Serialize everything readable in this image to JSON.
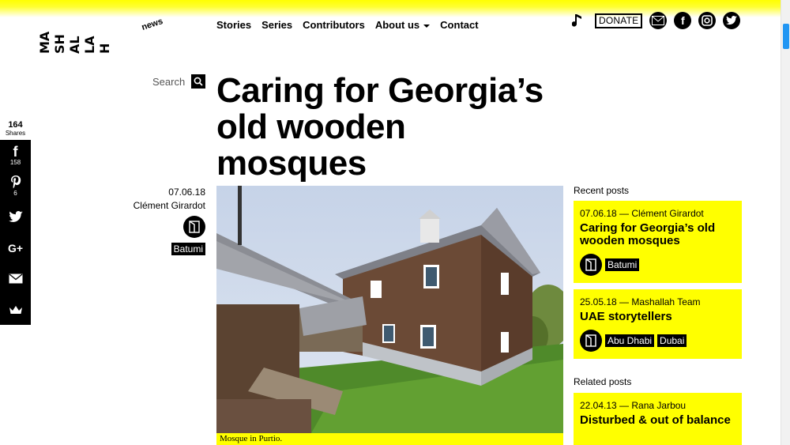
{
  "logo": {
    "text": "MA SH AL LA H",
    "lines": [
      "MA",
      "SH",
      "AL",
      "LA",
      "H"
    ],
    "tagline": "news"
  },
  "nav": {
    "items": [
      "Stories",
      "Series",
      "Contributors",
      "About us",
      "Contact"
    ]
  },
  "header": {
    "donate_label": "DONATE",
    "icons": [
      "music-note-icon",
      "mail-icon",
      "facebook-icon",
      "instagram-icon",
      "twitter-icon"
    ]
  },
  "search": {
    "label": "Search"
  },
  "shares": {
    "count": "164",
    "label": "Shares",
    "buttons": [
      {
        "icon": "facebook-icon",
        "glyph": "f",
        "count": "158"
      },
      {
        "icon": "pinterest-icon",
        "glyph": "P",
        "count": "6"
      },
      {
        "icon": "twitter-icon",
        "glyph": "🐦",
        "count": ""
      },
      {
        "icon": "google-plus-icon",
        "glyph": "G+",
        "count": ""
      },
      {
        "icon": "email-icon",
        "glyph": "✉",
        "count": ""
      },
      {
        "icon": "sumo-crown-icon",
        "glyph": "♛",
        "count": ""
      }
    ]
  },
  "article": {
    "title": "Caring for Georgia’s old wooden mosques",
    "date": "07.06.18",
    "author": "Clément Girardot",
    "tag": "Batumi",
    "caption": "Mosque in Purtio."
  },
  "sidebar": {
    "recent_heading": "Recent posts",
    "recent": [
      {
        "meta": "07.06.18 — Clément Girardot",
        "title": "Caring for Georgia’s old wooden mosques",
        "tags": [
          "Batumi"
        ]
      },
      {
        "meta": "25.05.18 — Mashallah Team",
        "title": "UAE storytellers",
        "tags": [
          "Abu Dhabi",
          "Dubai"
        ]
      }
    ],
    "related_heading": "Related posts",
    "related": [
      {
        "meta": "22.04.13 — Rana Jarbou",
        "title": "Disturbed & out of balance"
      }
    ]
  },
  "colors": {
    "accent": "#ffff00",
    "ink": "#000000"
  }
}
